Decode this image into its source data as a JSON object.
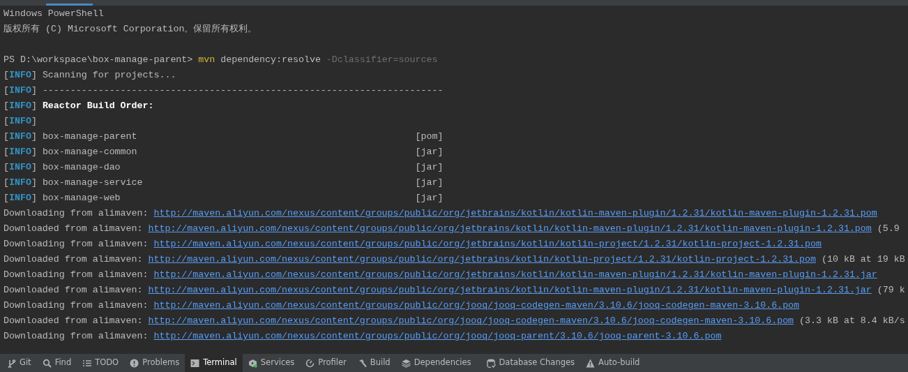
{
  "tab_strip": {
    "selected_indicator": true
  },
  "terminal_lines": [
    {
      "kind": "plain",
      "text": "Windows PowerShell"
    },
    {
      "kind": "plain",
      "text": "版权所有 (C) Microsoft Corporation。保留所有权利。"
    },
    {
      "kind": "prompt",
      "prompt": "PS D:\\workspace\\box-manage-parent>",
      "command": "mvn",
      "args": "dependency:resolve",
      "option": "-Dclassifier=sources"
    },
    {
      "kind": "info",
      "tag": "[INFO]",
      "text": "Scanning for projects..."
    },
    {
      "kind": "info",
      "tag": "[INFO]",
      "text": "------------------------------------------------------------------------"
    },
    {
      "kind": "info",
      "tag": "[INFO]",
      "text": "Reactor Build Order:",
      "bold": true
    },
    {
      "kind": "info",
      "tag": "[INFO]"
    },
    {
      "kind": "info",
      "tag": "[INFO]",
      "text": "box-manage-parent",
      "packaging": "[pom]"
    },
    {
      "kind": "info",
      "tag": "[INFO]",
      "text": "box-manage-common",
      "packaging": "[jar]"
    },
    {
      "kind": "info",
      "tag": "[INFO]",
      "text": "box-manage-dao",
      "packaging": "[jar]"
    },
    {
      "kind": "info",
      "tag": "[INFO]",
      "text": "box-manage-service",
      "packaging": "[jar]"
    },
    {
      "kind": "info",
      "tag": "[INFO]",
      "text": "box-manage-web",
      "packaging": "[jar]"
    },
    {
      "kind": "download",
      "text": "Downloading from alimaven:",
      "url": "http://maven.aliyun.com/nexus/content/groups/public/org/jetbrains/kotlin/kotlin-maven-plugin/1.2.31/kotlin-maven-plugin-1.2.31.pom"
    },
    {
      "kind": "download",
      "text": "Downloaded from alimaven:",
      "url": "http://maven.aliyun.com/nexus/content/groups/public/org/jetbrains/kotlin/kotlin-maven-plugin/1.2.31/kotlin-maven-plugin-1.2.31.pom",
      "suffix": "(5.9"
    },
    {
      "kind": "download",
      "text": "Downloading from alimaven:",
      "url": "http://maven.aliyun.com/nexus/content/groups/public/org/jetbrains/kotlin/kotlin-project/1.2.31/kotlin-project-1.2.31.pom"
    },
    {
      "kind": "download",
      "text": "Downloaded from alimaven:",
      "url": "http://maven.aliyun.com/nexus/content/groups/public/org/jetbrains/kotlin/kotlin-project/1.2.31/kotlin-project-1.2.31.pom",
      "suffix": "(10 kB at 19 kB"
    },
    {
      "kind": "download",
      "text": "Downloading from alimaven:",
      "url": "http://maven.aliyun.com/nexus/content/groups/public/org/jetbrains/kotlin/kotlin-maven-plugin/1.2.31/kotlin-maven-plugin-1.2.31.jar"
    },
    {
      "kind": "download",
      "text": "Downloaded from alimaven:",
      "url": "http://maven.aliyun.com/nexus/content/groups/public/org/jetbrains/kotlin/kotlin-maven-plugin/1.2.31/kotlin-maven-plugin-1.2.31.jar",
      "suffix": "(79 k"
    },
    {
      "kind": "download",
      "text": "Downloading from alimaven:",
      "url": "http://maven.aliyun.com/nexus/content/groups/public/org/jooq/jooq-codegen-maven/3.10.6/jooq-codegen-maven-3.10.6.pom"
    },
    {
      "kind": "download",
      "text": "Downloaded from alimaven:",
      "url": "http://maven.aliyun.com/nexus/content/groups/public/org/jooq/jooq-codegen-maven/3.10.6/jooq-codegen-maven-3.10.6.pom",
      "suffix": "(3.3 kB at 8.4 kB/s"
    },
    {
      "kind": "download",
      "text": "Downloading from alimaven:",
      "url": "http://maven.aliyun.com/nexus/content/groups/public/org/jooq/jooq-parent/3.10.6/jooq-parent-3.10.6.pom"
    }
  ],
  "tool_window_bar": [
    {
      "kind": "git",
      "label": "Git",
      "selected": false
    },
    {
      "kind": "find",
      "label": "Find",
      "selected": false
    },
    {
      "kind": "todo",
      "label": "TODO",
      "selected": false
    },
    {
      "kind": "problems",
      "label": "Problems",
      "selected": false
    },
    {
      "kind": "terminal",
      "label": "Terminal",
      "selected": true
    },
    {
      "kind": "services",
      "label": "Services",
      "selected": false
    },
    {
      "kind": "profiler",
      "label": "Profiler",
      "selected": false
    },
    {
      "kind": "build",
      "label": "Build",
      "selected": false
    },
    {
      "kind": "dependencies",
      "label": "Dependencies",
      "selected": false
    },
    {
      "kind": "database",
      "label": "Database Changes",
      "selected": false
    },
    {
      "kind": "warning",
      "label": "Auto-build",
      "selected": false
    }
  ]
}
